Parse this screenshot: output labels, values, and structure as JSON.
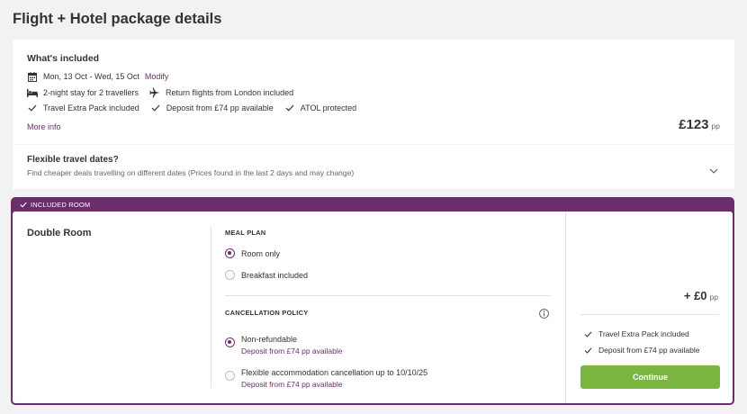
{
  "page": {
    "title": "Flight + Hotel package details"
  },
  "included": {
    "heading": "What's included",
    "dates": "Mon, 13 Oct - Wed, 15 Oct",
    "modify_label": "Modify",
    "stay": "2-night stay for 2 travellers",
    "flights": "Return flights from London included",
    "features": [
      "Travel Extra Pack included",
      "Deposit from £74 pp available",
      "ATOL protected"
    ],
    "more_info_label": "More info",
    "price": "£123",
    "price_unit": "pp"
  },
  "flexible": {
    "heading": "Flexible travel dates?",
    "description": "Find cheaper deals travelling on different dates (Prices found in the last 2 days and may change)"
  },
  "room": {
    "tag": "INCLUDED ROOM",
    "name": "Double Room",
    "meal_plan_label": "MEAL PLAN",
    "meal_options": [
      {
        "label": "Room only",
        "selected": true
      },
      {
        "label": "Breakfast included",
        "selected": false
      }
    ],
    "cancellation_label": "CANCELLATION POLICY",
    "cancellation_options": [
      {
        "label": "Non-refundable",
        "sub": "Deposit from £74 pp available",
        "selected": true
      },
      {
        "label": "Flexible accommodation cancellation up to 10/10/25",
        "sub": "Deposit from £74 pp available",
        "selected": false
      }
    ],
    "price": "+ £0",
    "price_unit": "pp",
    "benefits": [
      "Travel Extra Pack included",
      "Deposit from £74 pp available"
    ],
    "continue_label": "Continue"
  },
  "colors": {
    "brand": "#6b2d6b",
    "cta": "#7ab640"
  }
}
